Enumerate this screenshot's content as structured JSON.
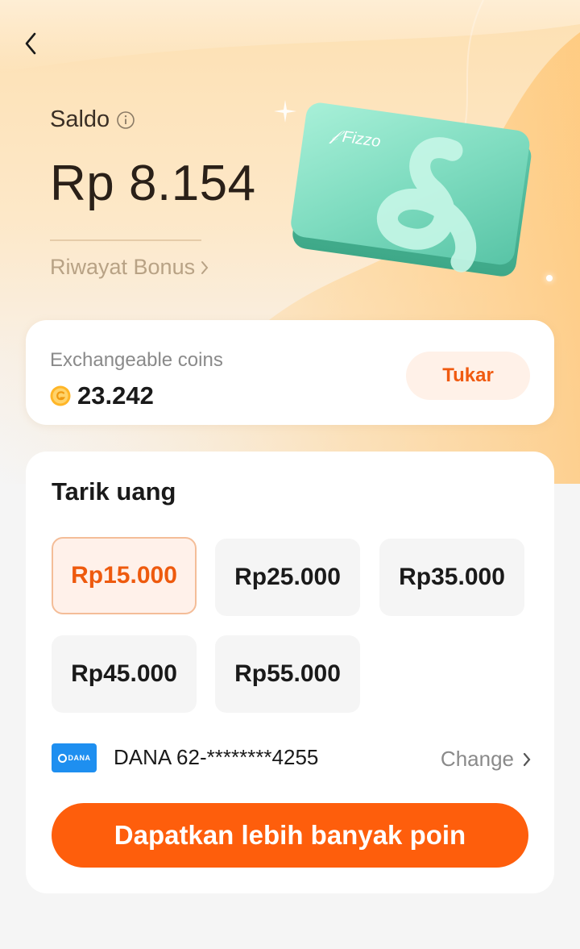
{
  "header": {
    "balance_label": "Saldo",
    "balance_value": "Rp 8.154",
    "history_link": "Riwayat Bonus",
    "card_brand": "Fizzo"
  },
  "coins": {
    "label": "Exchangeable coins",
    "value": "23.242",
    "exchange_button": "Tukar"
  },
  "withdraw": {
    "title": "Tarik uang",
    "amounts": [
      {
        "label": "Rp15.000",
        "selected": true
      },
      {
        "label": "Rp25.000",
        "selected": false
      },
      {
        "label": "Rp35.000",
        "selected": false
      },
      {
        "label": "Rp45.000",
        "selected": false
      },
      {
        "label": "Rp55.000",
        "selected": false
      }
    ],
    "payment": {
      "logo_text": "DANA",
      "account": "DANA 62-********4255",
      "change_label": "Change"
    },
    "cta_label": "Dapatkan lebih banyak poin"
  },
  "colors": {
    "accent": "#fe5e0c",
    "selected_bg": "#fff1ea",
    "selected_border": "#f4bd98",
    "card_green": "#7fe0c4",
    "dana_blue": "#1e8ff0"
  }
}
